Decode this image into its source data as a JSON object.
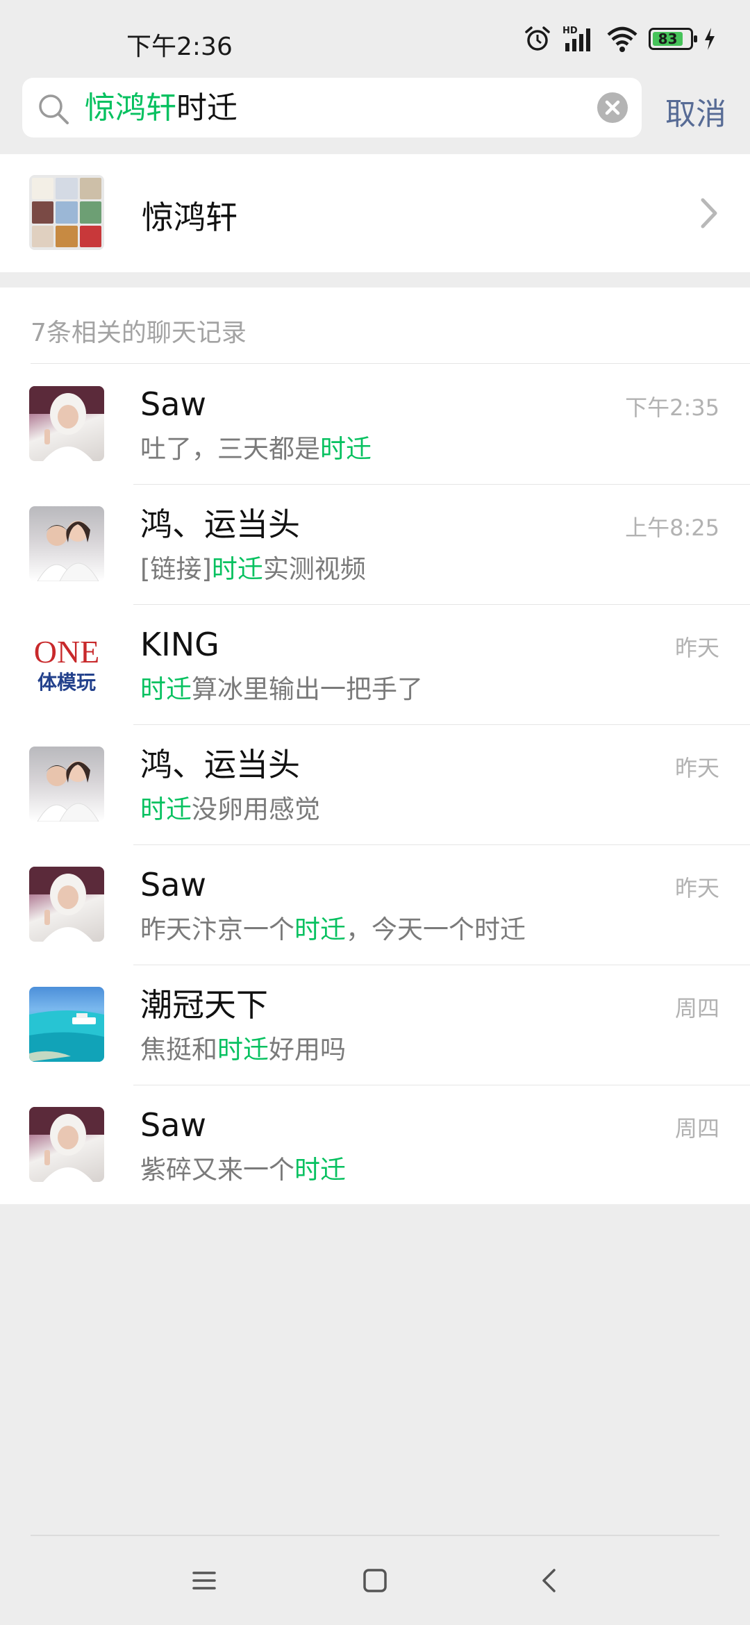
{
  "status_bar": {
    "time": "下午2:36",
    "network_label": "HD",
    "battery": "83"
  },
  "search": {
    "query_highlight": "惊鸿轩",
    "query_rest": "时迁",
    "cancel_label": "取消"
  },
  "contact": {
    "name": "惊鸿轩"
  },
  "records": {
    "header": "7条相关的聊天记录",
    "items": [
      {
        "name": "Saw",
        "time": "下午2:35",
        "avatar": "saw",
        "msg": [
          {
            "t": "吐了，三天都是",
            "h": false
          },
          {
            "t": "时迁",
            "h": true
          }
        ]
      },
      {
        "name": "鸿、运当头",
        "time": "上午8:25",
        "avatar": "couple",
        "msg": [
          {
            "t": "[链接]",
            "h": false
          },
          {
            "t": "时迁",
            "h": true
          },
          {
            "t": "实测视频",
            "h": false
          }
        ]
      },
      {
        "name": "KING",
        "time": "昨天",
        "avatar": "king",
        "msg": [
          {
            "t": "时迁",
            "h": true
          },
          {
            "t": "算冰里输出一把手了",
            "h": false
          }
        ]
      },
      {
        "name": "鸿、运当头",
        "time": "昨天",
        "avatar": "couple",
        "msg": [
          {
            "t": "时迁",
            "h": true
          },
          {
            "t": "没卵用感觉",
            "h": false
          }
        ]
      },
      {
        "name": "Saw",
        "time": "昨天",
        "avatar": "saw",
        "msg": [
          {
            "t": "昨天汴京一个",
            "h": false
          },
          {
            "t": "时迁",
            "h": true
          },
          {
            "t": "，今天一个时迁",
            "h": false
          }
        ]
      },
      {
        "name": "潮冠天下",
        "time": "周四",
        "avatar": "sea",
        "msg": [
          {
            "t": "焦挺和",
            "h": false
          },
          {
            "t": "时迁",
            "h": true
          },
          {
            "t": "好用吗",
            "h": false
          }
        ]
      },
      {
        "name": "Saw",
        "time": "周四",
        "avatar": "saw",
        "msg": [
          {
            "t": "紫碎又来一个",
            "h": false
          },
          {
            "t": "时迁",
            "h": true
          }
        ]
      }
    ]
  },
  "king_avatar": {
    "line1": "ONE",
    "line2": "体模玩"
  },
  "colors": {
    "highlight": "#07c160",
    "link_blue": "#576b95",
    "background": "#ededed"
  },
  "icons": [
    "alarm-icon",
    "signal-icon",
    "wifi-icon",
    "battery-icon",
    "charging-icon",
    "search-icon",
    "clear-icon",
    "chevron-right-icon",
    "menu-icon",
    "home-icon",
    "back-icon"
  ]
}
